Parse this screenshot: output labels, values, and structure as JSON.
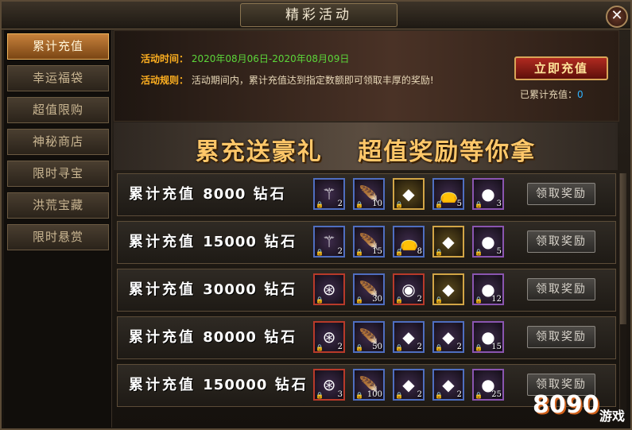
{
  "window": {
    "title": "精彩活动",
    "close_glyph": "✕"
  },
  "sidebar": {
    "items": [
      {
        "label": "累计充值",
        "active": true
      },
      {
        "label": "幸运福袋",
        "active": false
      },
      {
        "label": "超值限购",
        "active": false
      },
      {
        "label": "神秘商店",
        "active": false
      },
      {
        "label": "限时寻宝",
        "active": false
      },
      {
        "label": "洪荒宝藏",
        "active": false
      },
      {
        "label": "限时悬赏",
        "active": false
      }
    ]
  },
  "info": {
    "time_label": "活动时间：",
    "time_value": "2020年08月06日-2020年08月09日",
    "rule_label": "活动规则：",
    "rule_value": "活动期间内，累计充值达到指定数额即可领取丰厚的奖励!",
    "charge_button": "立即充值",
    "charged_label": "已累计充值：",
    "charged_value": "0"
  },
  "banner": {
    "left": "累充送豪礼",
    "right": "超值奖励等你拿"
  },
  "tiers": [
    {
      "prefix": "累计充值",
      "amount": "8000",
      "unit": "钻石",
      "claim": "领取奖励",
      "rewards": [
        {
          "icon": "scepter-icon",
          "glyph": "⚚",
          "count": "2",
          "style": "blue"
        },
        {
          "icon": "feather-icon",
          "glyph": "🪶",
          "count": "10",
          "style": "blue"
        },
        {
          "icon": "crystal-icon",
          "glyph": "◆",
          "count": "",
          "style": "gold"
        },
        {
          "icon": "bag-icon",
          "glyph": "👝",
          "count": "5",
          "style": "blue"
        },
        {
          "icon": "gem-ring-icon",
          "glyph": "●",
          "count": "3",
          "style": ""
        }
      ]
    },
    {
      "prefix": "累计充值",
      "amount": "15000",
      "unit": "钻石",
      "claim": "领取奖励",
      "rewards": [
        {
          "icon": "scepter-icon",
          "glyph": "⚚",
          "count": "2",
          "style": "blue"
        },
        {
          "icon": "feather-icon",
          "glyph": "🪶",
          "count": "15",
          "style": "blue"
        },
        {
          "icon": "bag-icon",
          "glyph": "👝",
          "count": "8",
          "style": "blue"
        },
        {
          "icon": "crystal-icon",
          "glyph": "◆",
          "count": "",
          "style": "gold"
        },
        {
          "icon": "gem-ring-icon",
          "glyph": "●",
          "count": "5",
          "style": ""
        }
      ]
    },
    {
      "prefix": "累计充值",
      "amount": "30000",
      "unit": "钻石",
      "claim": "领取奖励",
      "rewards": [
        {
          "icon": "compass-icon",
          "glyph": "⊛",
          "count": "",
          "style": "red"
        },
        {
          "icon": "feather-icon",
          "glyph": "🪶",
          "count": "30",
          "style": "blue"
        },
        {
          "icon": "orb-icon",
          "glyph": "◉",
          "count": "2",
          "style": "red"
        },
        {
          "icon": "crystal-icon",
          "glyph": "◆",
          "count": "",
          "style": "gold"
        },
        {
          "icon": "gem-ring-icon",
          "glyph": "●",
          "count": "12",
          "style": ""
        }
      ]
    },
    {
      "prefix": "累计充值",
      "amount": "80000",
      "unit": "钻石",
      "claim": "领取奖励",
      "rewards": [
        {
          "icon": "compass-icon",
          "glyph": "⊛",
          "count": "2",
          "style": "red"
        },
        {
          "icon": "feather-icon",
          "glyph": "🪶",
          "count": "50",
          "style": "blue"
        },
        {
          "icon": "green-crystal-icon",
          "glyph": "◆",
          "count": "2",
          "style": "blue"
        },
        {
          "icon": "crystal-icon",
          "glyph": "◆",
          "count": "2",
          "style": "blue"
        },
        {
          "icon": "gem-ring-icon",
          "glyph": "●",
          "count": "15",
          "style": ""
        }
      ]
    },
    {
      "prefix": "累计充值",
      "amount": "150000",
      "unit": "钻石",
      "claim": "领取奖励",
      "rewards": [
        {
          "icon": "compass-icon",
          "glyph": "⊛",
          "count": "3",
          "style": "red"
        },
        {
          "icon": "feather-icon",
          "glyph": "🪶",
          "count": "100",
          "style": "blue"
        },
        {
          "icon": "green-crystal-icon",
          "glyph": "◆",
          "count": "2",
          "style": "blue"
        },
        {
          "icon": "crystal-icon",
          "glyph": "◆",
          "count": "2",
          "style": "blue"
        },
        {
          "icon": "gem-ring-icon",
          "glyph": "●",
          "count": "25",
          "style": ""
        }
      ]
    }
  ],
  "watermark": {
    "number": "8090",
    "text": "游戏"
  }
}
